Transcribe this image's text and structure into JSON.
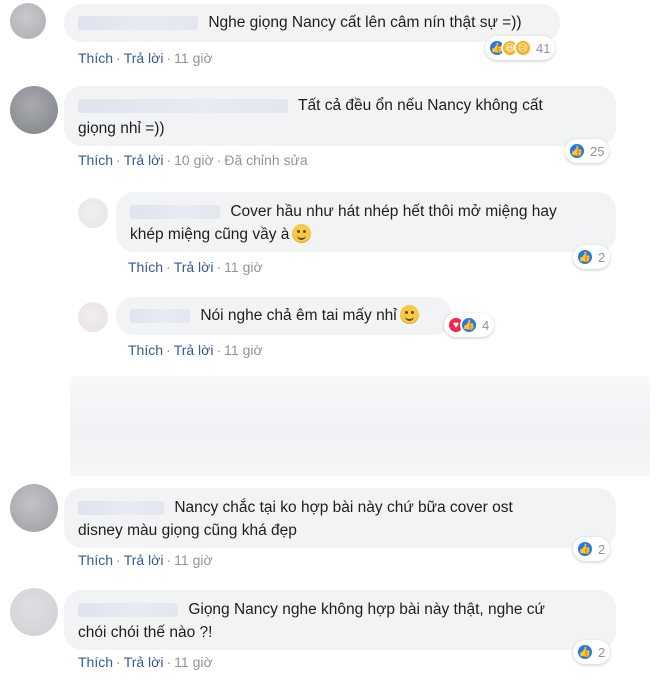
{
  "labels": {
    "like": "Thích",
    "reply": "Trả lời",
    "separator": "·"
  },
  "comments": [
    {
      "text": "Nghe giọng Nancy cất lên câm nín thật sự =))",
      "time": "11 giờ",
      "reactions": [
        "like-icon",
        "haha-icon",
        "sad-icon"
      ],
      "reaction_count": "41"
    },
    {
      "text_line1": "Tất cả đều ổn nếu Nancy không cất",
      "text_line2": "giọng nhỉ =))",
      "time": "10 giờ",
      "edited": "Đã chỉnh sửa",
      "reactions": [
        "like-icon"
      ],
      "reaction_count": "25"
    },
    {
      "reply": true,
      "text_line1": "Cover hầu như hát nhép hết thôi mở miệng hay",
      "text_line2": "khép miệng cũng vầy à",
      "emoji": "smiley-emoji",
      "time": "11 giờ",
      "reactions": [
        "like-icon"
      ],
      "reaction_count": "2"
    },
    {
      "reply": true,
      "text": "Nói nghe chả êm tai mấy nhỉ",
      "emoji": "smiley-emoji",
      "time": "11 giờ",
      "reactions": [
        "love-icon",
        "like-icon"
      ],
      "reaction_count": "4"
    },
    {
      "text_line1": "Nancy chắc tại ko hợp bài này chứ bữa cover ost",
      "text_line2": "disney màu giọng cũng khá đẹp",
      "time": "11 giờ",
      "reactions": [
        "like-icon"
      ],
      "reaction_count": "2"
    },
    {
      "text_line1": "Giọng Nancy nghe không hợp bài này thật, nghe cứ",
      "text_line2": "chói chói thế nào ?!",
      "time": "11 giờ",
      "reactions": [
        "like-icon"
      ],
      "reaction_count": "2"
    }
  ],
  "colors": {
    "bubble": "#f2f3f5",
    "link": "#385898",
    "meta": "#90949c",
    "like": "#2078f4",
    "love": "#f0284a",
    "haha": "#f7b125"
  }
}
